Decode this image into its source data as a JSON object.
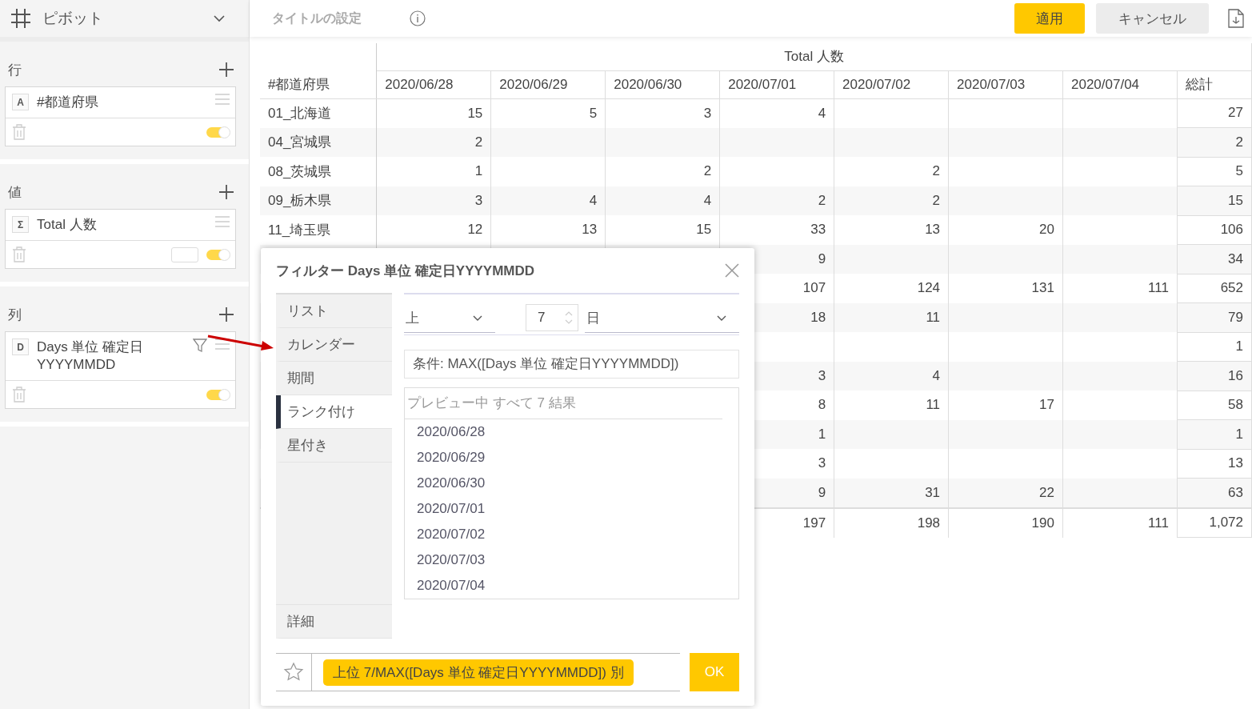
{
  "sidebar": {
    "title": "ピボット",
    "sections": [
      {
        "label": "行",
        "fields": [
          {
            "type_badge": "A",
            "name": "#都道府県",
            "filter": false,
            "format_box": false,
            "on": true
          }
        ]
      },
      {
        "label": "値",
        "fields": [
          {
            "type_badge": "Σ",
            "name": "Total 人数",
            "filter": false,
            "format_box": true,
            "on": true
          }
        ]
      },
      {
        "label": "列",
        "fields": [
          {
            "type_badge": "D",
            "name": "Days 単位 確定日YYYYMMDD",
            "filter": true,
            "format_box": false,
            "on": true
          }
        ]
      }
    ]
  },
  "topbar": {
    "title_placeholder": "タイトルの設定",
    "apply_button": "適用",
    "cancel_button": "キャンセル"
  },
  "table": {
    "group_header": "Total 人数",
    "row_header": "#都道府県",
    "columns": [
      "2020/06/28",
      "2020/06/29",
      "2020/06/30",
      "2020/07/01",
      "2020/07/02",
      "2020/07/03",
      "2020/07/04",
      "総計"
    ],
    "rows": [
      {
        "label": "01_北海道",
        "cells": [
          "15",
          "5",
          "3",
          "4",
          null,
          null,
          null,
          "27"
        ]
      },
      {
        "label": "04_宮城県",
        "cells": [
          "2",
          null,
          null,
          null,
          null,
          null,
          null,
          "2"
        ]
      },
      {
        "label": "08_茨城県",
        "cells": [
          "1",
          null,
          "2",
          null,
          "2",
          null,
          null,
          "5"
        ]
      },
      {
        "label": "09_栃木県",
        "cells": [
          "3",
          "4",
          "4",
          "2",
          "2",
          null,
          null,
          "15"
        ]
      },
      {
        "label": "11_埼玉県",
        "cells": [
          "12",
          "13",
          "15",
          "33",
          "13",
          "20",
          null,
          "106"
        ]
      },
      {
        "cells": [
          null,
          null,
          null,
          "9",
          null,
          null,
          null,
          "34"
        ]
      },
      {
        "cells": [
          null,
          null,
          null,
          "107",
          "124",
          "131",
          "111",
          "652"
        ]
      },
      {
        "cells": [
          null,
          null,
          null,
          "18",
          "11",
          null,
          null,
          "79"
        ]
      },
      {
        "cells": [
          null,
          null,
          null,
          null,
          null,
          null,
          null,
          "1"
        ]
      },
      {
        "cells": [
          null,
          null,
          null,
          "3",
          "4",
          null,
          null,
          "16"
        ]
      },
      {
        "cells": [
          null,
          null,
          null,
          "8",
          "11",
          "17",
          null,
          "58"
        ]
      },
      {
        "cells": [
          null,
          null,
          null,
          "1",
          null,
          null,
          null,
          "1"
        ]
      },
      {
        "cells": [
          null,
          null,
          null,
          "3",
          null,
          null,
          null,
          "13"
        ]
      },
      {
        "cells": [
          null,
          null,
          null,
          "9",
          "31",
          "22",
          null,
          "63"
        ]
      }
    ],
    "total_row": {
      "cells": [
        null,
        null,
        null,
        "197",
        "198",
        "190",
        "111",
        "1,072"
      ]
    }
  },
  "filter_dialog": {
    "title": "フィルター Days 単位 確定日YYYYMMDD",
    "tabs": [
      {
        "label": "リスト",
        "selected": false
      },
      {
        "label": "カレンダー",
        "selected": false
      },
      {
        "label": "期間",
        "selected": false
      },
      {
        "label": "ランク付け",
        "selected": true
      },
      {
        "label": "星付き",
        "selected": false
      }
    ],
    "detail_tab": {
      "label": "詳細",
      "selected": false
    },
    "direction_select": "上",
    "count_spinner": "7",
    "unit_select": "日",
    "condition": "条件: MAX([Days 単位 確定日YYYYMMDD])",
    "preview_header": "プレビュー中 すべて 7 結果",
    "preview_items": [
      "2020/06/28",
      "2020/06/29",
      "2020/06/30",
      "2020/07/01",
      "2020/07/02",
      "2020/07/03",
      "2020/07/04"
    ],
    "summary_chip": "上位 7/MAX([Days 単位 確定日YYYYMMDD]) 別",
    "ok_button": "OK"
  }
}
